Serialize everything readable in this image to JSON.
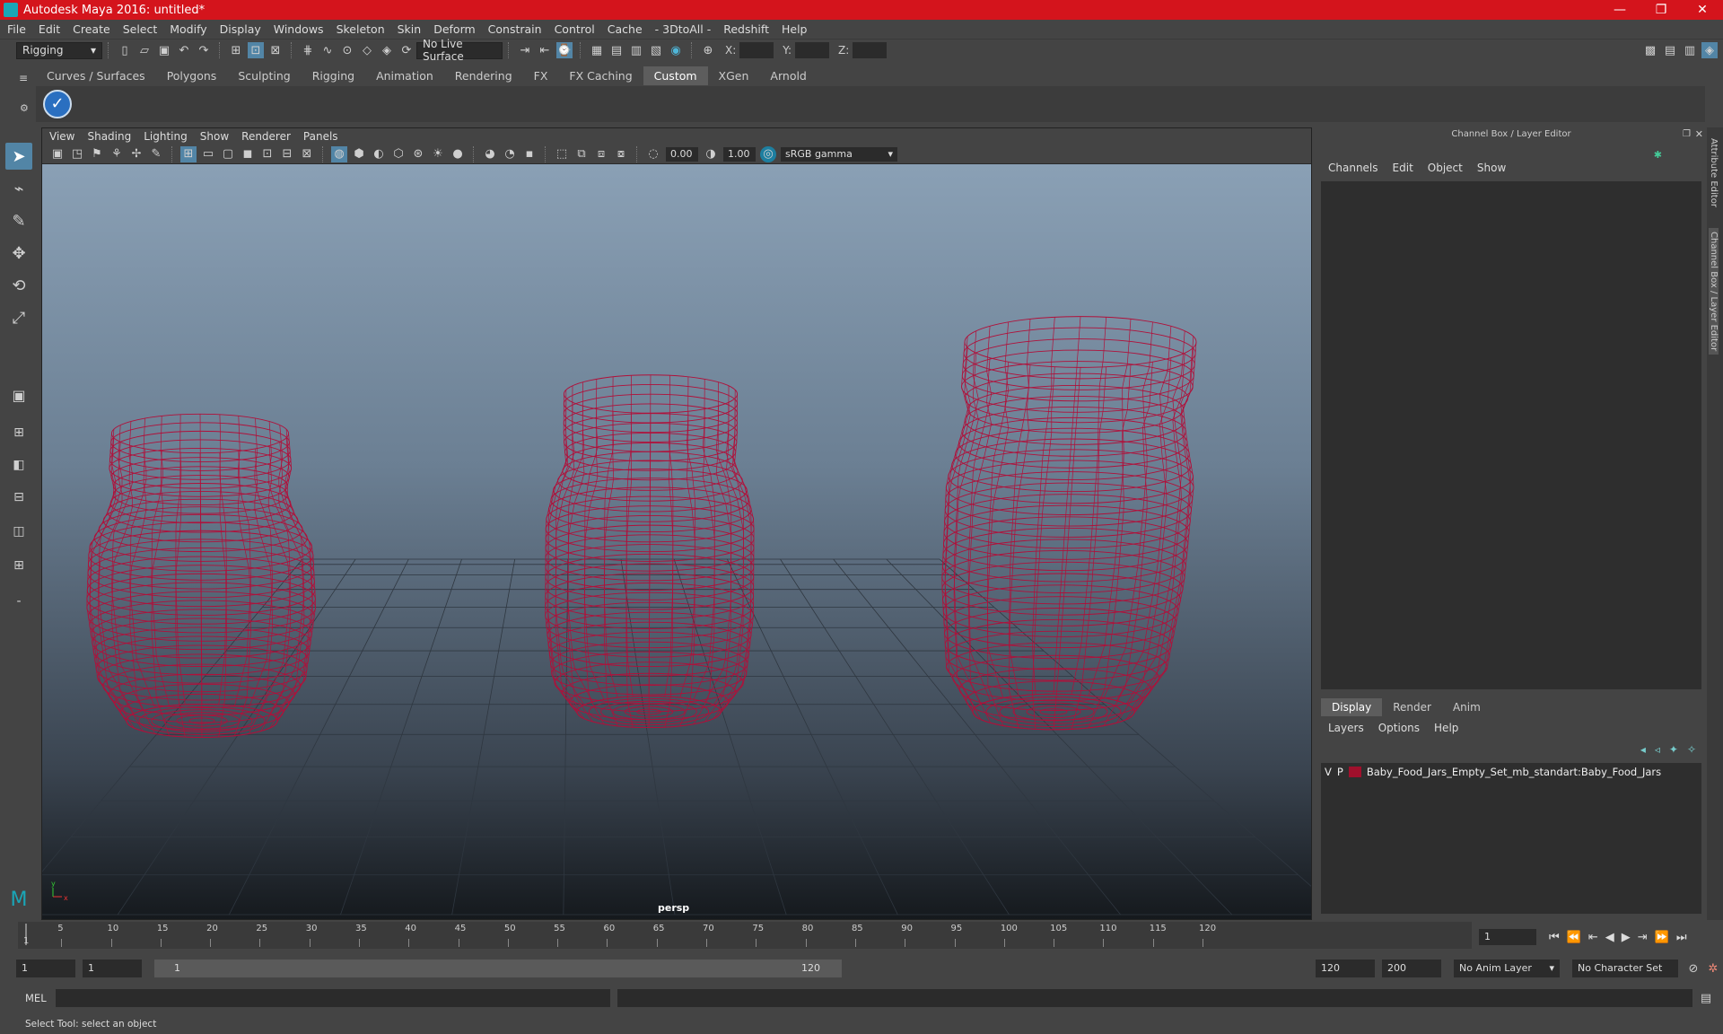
{
  "window": {
    "title": "Autodesk Maya 2016: untitled*"
  },
  "menubar": [
    "File",
    "Edit",
    "Create",
    "Select",
    "Modify",
    "Display",
    "Windows",
    "Skeleton",
    "Skin",
    "Deform",
    "Constrain",
    "Control",
    "Cache",
    "- 3DtoAll -",
    "Redshift",
    "Help"
  ],
  "statusline": {
    "menu_set": "Rigging",
    "live_surface": "No Live Surface",
    "x_label": "X:",
    "y_label": "Y:",
    "z_label": "Z:"
  },
  "shelf": {
    "tabs": [
      "Curves / Surfaces",
      "Polygons",
      "Sculpting",
      "Rigging",
      "Animation",
      "Rendering",
      "FX",
      "FX Caching",
      "Custom",
      "XGen",
      "Arnold"
    ],
    "active_tab": "Custom"
  },
  "viewport": {
    "menu": [
      "View",
      "Shading",
      "Lighting",
      "Show",
      "Renderer",
      "Panels"
    ],
    "exposure": "0.00",
    "gamma": "1.00",
    "color_space": "sRGB gamma",
    "camera_label": "persp"
  },
  "channelbox": {
    "title": "Channel Box / Layer Editor",
    "menu": [
      "Channels",
      "Edit",
      "Object",
      "Show"
    ],
    "layer_tabs": [
      "Display",
      "Render",
      "Anim"
    ],
    "layer_menu": [
      "Layers",
      "Options",
      "Help"
    ],
    "layer": {
      "v": "V",
      "p": "P",
      "name": "Baby_Food_Jars_Empty_Set_mb_standart:Baby_Food_Jars",
      "color": "#a0102c"
    }
  },
  "sidetabs": [
    "Attribute Editor",
    "Channel Box / Layer Editor"
  ],
  "timeline": {
    "ticks": [
      "5",
      "10",
      "15",
      "20",
      "25",
      "30",
      "35",
      "40",
      "45",
      "50",
      "55",
      "60",
      "65",
      "70",
      "75",
      "80",
      "85",
      "90",
      "95",
      "100",
      "105",
      "110",
      "115",
      "120"
    ],
    "start_marker": "1",
    "current_frame": "1"
  },
  "range": {
    "start": "1",
    "playback_start": "1",
    "slider_start": "1",
    "slider_end": "120",
    "playback_end": "120",
    "end": "200",
    "anim_layer": "No Anim Layer",
    "character_set": "No Character Set"
  },
  "mel": {
    "label": "MEL"
  },
  "help_line": "Select Tool: select an object",
  "colors": {
    "titlebar": "#d4141c",
    "wireframe": "#b0103a",
    "active_tab": "#5d5d5d"
  }
}
